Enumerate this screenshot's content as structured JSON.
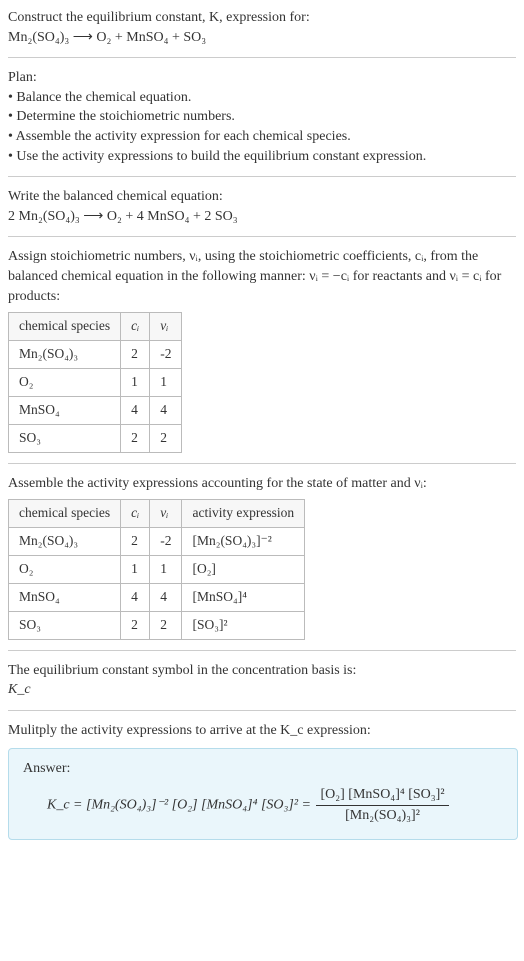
{
  "intro": {
    "line1": "Construct the equilibrium constant, K, expression for:",
    "eq_unbalanced": "Mn₂(SO₄)₃  ⟶  O₂ + MnSO₄ + SO₃"
  },
  "plan": {
    "title": "Plan:",
    "items": [
      "• Balance the chemical equation.",
      "• Determine the stoichiometric numbers.",
      "• Assemble the activity expression for each chemical species.",
      "• Use the activity expressions to build the equilibrium constant expression."
    ]
  },
  "balanced": {
    "title": "Write the balanced chemical equation:",
    "eq": "2 Mn₂(SO₄)₃  ⟶  O₂ + 4 MnSO₄ + 2 SO₃"
  },
  "assign": {
    "text": "Assign stoichiometric numbers, νᵢ, using the stoichiometric coefficients, cᵢ, from the balanced chemical equation in the following manner: νᵢ = −cᵢ for reactants and νᵢ = cᵢ for products:",
    "headers": [
      "chemical species",
      "cᵢ",
      "νᵢ"
    ],
    "rows": [
      {
        "sp": "Mn₂(SO₄)₃",
        "c": "2",
        "v": "-2"
      },
      {
        "sp": "O₂",
        "c": "1",
        "v": "1"
      },
      {
        "sp": "MnSO₄",
        "c": "4",
        "v": "4"
      },
      {
        "sp": "SO₃",
        "c": "2",
        "v": "2"
      }
    ]
  },
  "activity": {
    "text": "Assemble the activity expressions accounting for the state of matter and νᵢ:",
    "headers": [
      "chemical species",
      "cᵢ",
      "νᵢ",
      "activity expression"
    ],
    "rows": [
      {
        "sp": "Mn₂(SO₄)₃",
        "c": "2",
        "v": "-2",
        "a": "[Mn₂(SO₄)₃]⁻²"
      },
      {
        "sp": "O₂",
        "c": "1",
        "v": "1",
        "a": "[O₂]"
      },
      {
        "sp": "MnSO₄",
        "c": "4",
        "v": "4",
        "a": "[MnSO₄]⁴"
      },
      {
        "sp": "SO₃",
        "c": "2",
        "v": "2",
        "a": "[SO₃]²"
      }
    ]
  },
  "symbol": {
    "line1": "The equilibrium constant symbol in the concentration basis is:",
    "line2": "K_c"
  },
  "multiply": {
    "text": "Mulitply the activity expressions to arrive at the K_c expression:"
  },
  "answer": {
    "label": "Answer:",
    "lhs": "K_c = [Mn₂(SO₄)₃]⁻² [O₂] [MnSO₄]⁴ [SO₃]² = ",
    "num": "[O₂] [MnSO₄]⁴ [SO₃]²",
    "den": "[Mn₂(SO₄)₃]²"
  },
  "chart_data": {
    "type": "table",
    "tables": [
      {
        "title": "stoichiometric numbers",
        "columns": [
          "chemical species",
          "c_i",
          "ν_i"
        ],
        "rows": [
          [
            "Mn2(SO4)3",
            2,
            -2
          ],
          [
            "O2",
            1,
            1
          ],
          [
            "MnSO4",
            4,
            4
          ],
          [
            "SO3",
            2,
            2
          ]
        ]
      },
      {
        "title": "activity expressions",
        "columns": [
          "chemical species",
          "c_i",
          "ν_i",
          "activity expression"
        ],
        "rows": [
          [
            "Mn2(SO4)3",
            2,
            -2,
            "[Mn2(SO4)3]^-2"
          ],
          [
            "O2",
            1,
            1,
            "[O2]"
          ],
          [
            "MnSO4",
            4,
            4,
            "[MnSO4]^4"
          ],
          [
            "SO3",
            2,
            2,
            "[SO3]^2"
          ]
        ]
      }
    ]
  }
}
